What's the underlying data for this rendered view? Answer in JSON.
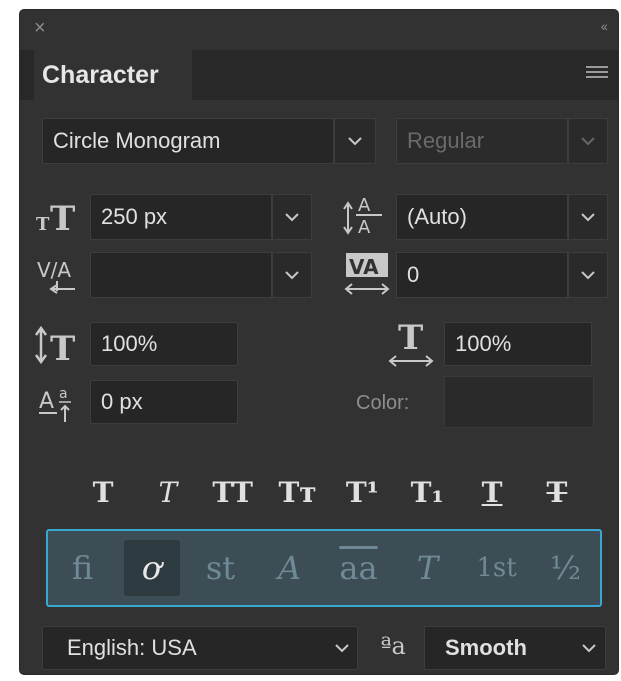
{
  "panel": {
    "close_glyph": "×",
    "collapse_glyph": "‹‹",
    "tab_label": "Character"
  },
  "font": {
    "family": "Circle Monogram",
    "style": "Regular"
  },
  "size": {
    "value": "250 px"
  },
  "leading": {
    "value": "(Auto)"
  },
  "kerning": {
    "value": ""
  },
  "tracking": {
    "value": "0"
  },
  "vertical_scale": {
    "value": "100%"
  },
  "horizontal_scale": {
    "value": "100%"
  },
  "baseline_shift": {
    "value": "0 px"
  },
  "color": {
    "label": "Color:",
    "swatch": "#2a2a2a"
  },
  "type_styles": {
    "bold": "T",
    "italic": "T",
    "all_caps": "TT",
    "small_caps": "Tт",
    "superscript": "T¹",
    "subscript": "T₁",
    "underline": "T",
    "strikethrough": "T"
  },
  "opentype": {
    "ligatures": "fi",
    "contextual": "ơ",
    "discretionary": "st",
    "swash": "A",
    "stylistic": "aa",
    "titling": "T",
    "ordinals": "1st",
    "fractions": "½"
  },
  "language": {
    "value": "English: USA"
  },
  "antialias": {
    "icon_text": "ªa",
    "value": "Smooth"
  },
  "colors": {
    "accent": "#39a8d0",
    "panel": "#323232",
    "field": "#262626"
  }
}
